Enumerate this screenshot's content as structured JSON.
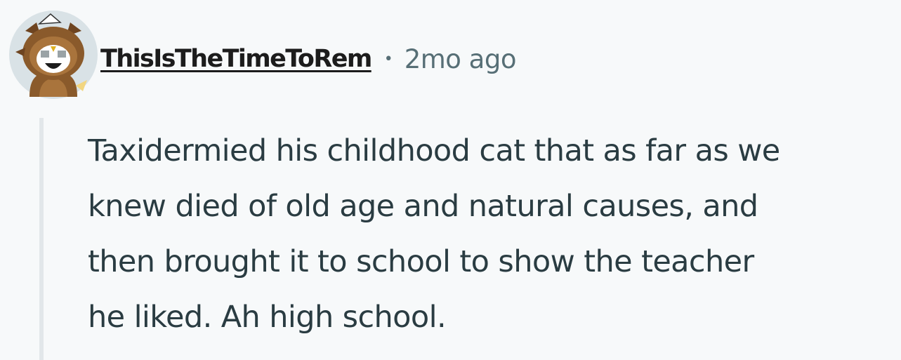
{
  "comment": {
    "author": "ThisIsTheTimeToRem",
    "separator": "•",
    "timestamp": "2mo ago",
    "body_lines": [
      "Taxidermied his childhood cat that as far as we",
      "knew died of old age and natural causes, and",
      "then brought it to school to show the teacher",
      "he liked. Ah high school."
    ]
  },
  "avatar": {
    "icon": "snoo-owl-costume-avatar-icon"
  },
  "colors": {
    "background": "#f7f9fa",
    "username": "#1c1c1c",
    "meta": "#576f76",
    "body": "#2a3c42",
    "thread_line": "#e2e7ea",
    "avatar_bg": "#d9e2e6"
  }
}
